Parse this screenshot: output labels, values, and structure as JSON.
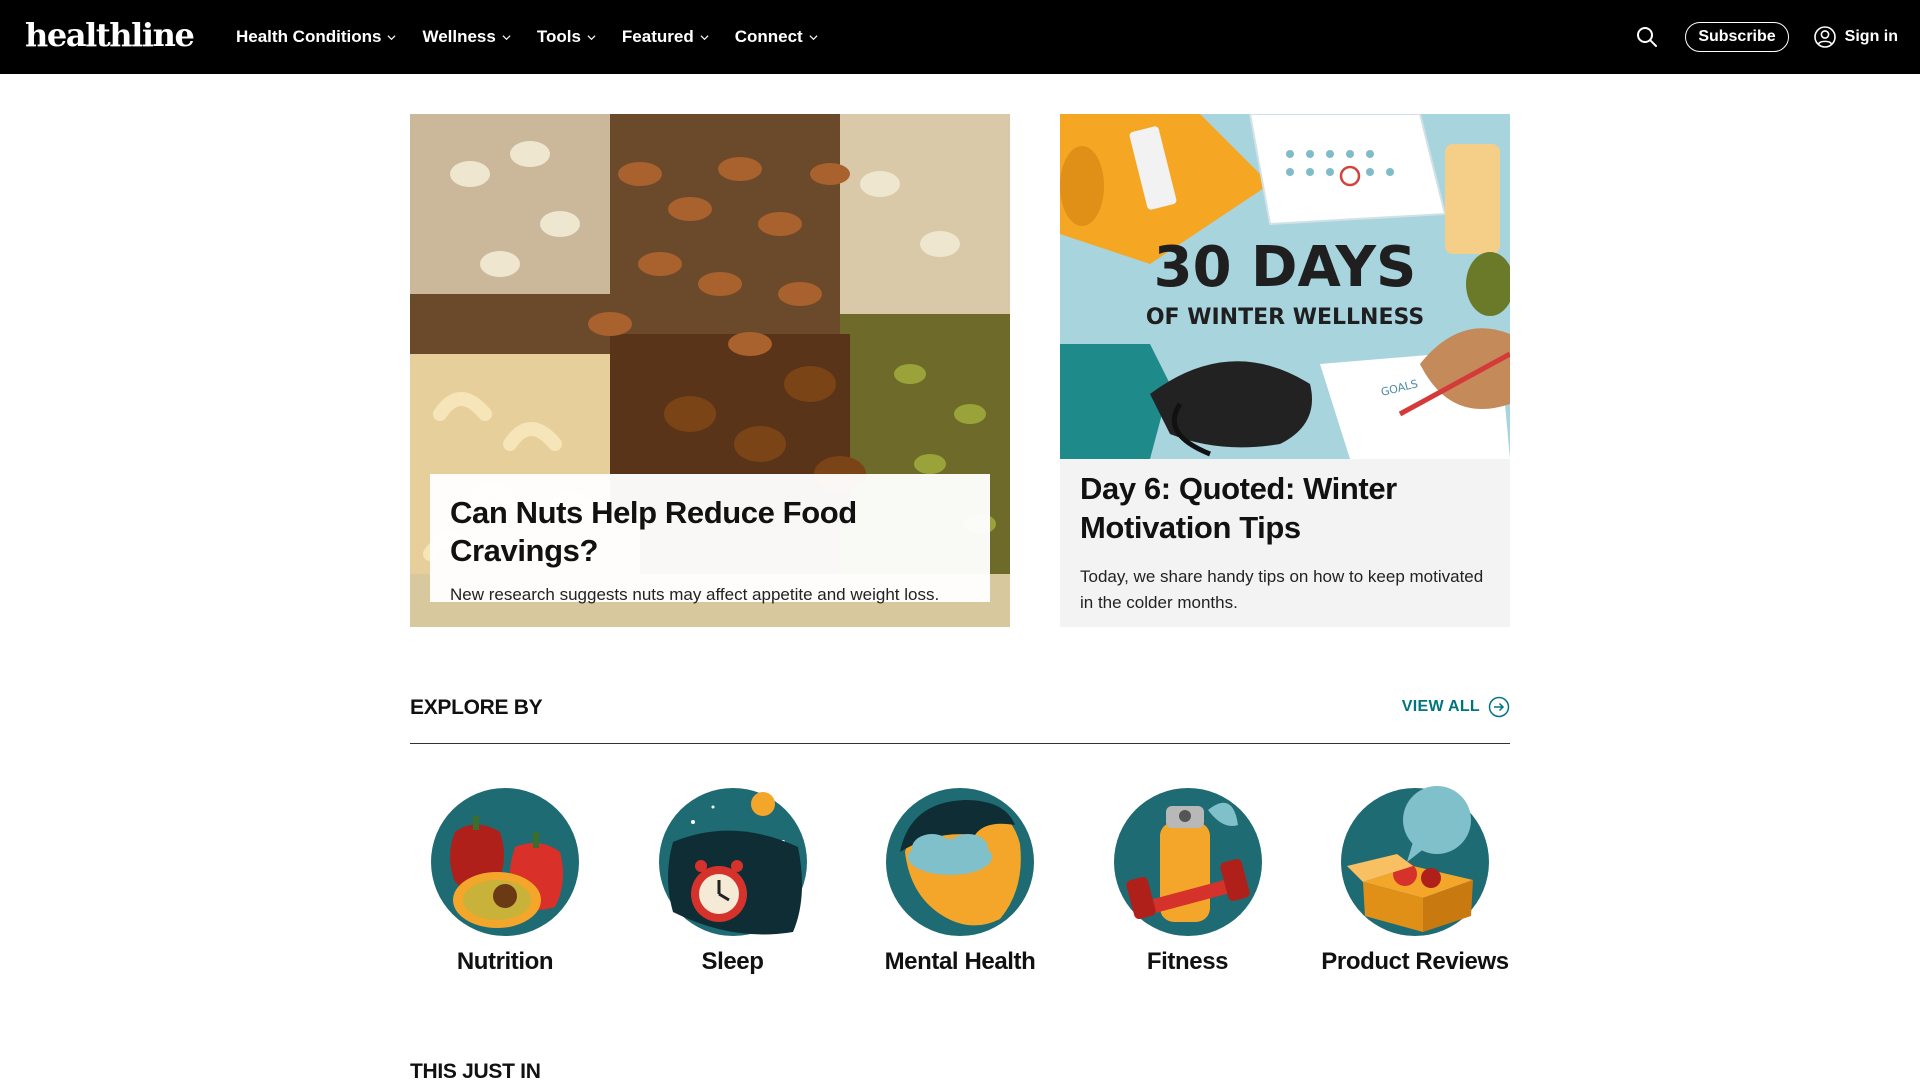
{
  "header": {
    "logo": "healthline",
    "nav": [
      {
        "label": "Health Conditions"
      },
      {
        "label": "Wellness"
      },
      {
        "label": "Tools"
      },
      {
        "label": "Featured"
      },
      {
        "label": "Connect"
      }
    ],
    "subscribe_label": "Subscribe",
    "signin_label": "Sign in"
  },
  "featured": [
    {
      "title": "Can Nuts Help Reduce Food Cravings?",
      "subtitle": "New research suggests nuts may affect appetite and weight loss."
    },
    {
      "title": "Day 6: Quoted: Winter Motivation Tips",
      "subtitle": "Today, we share handy tips on how to keep motivated in the colder months.",
      "art_line1": "30 DAYS",
      "art_line2": "OF WINTER WELLNESS",
      "art_note": "GOALS"
    }
  ],
  "explore": {
    "title": "EXPLORE BY",
    "view_all": "VIEW ALL",
    "topics": [
      {
        "label": "Nutrition",
        "icon": "nutrition-icon"
      },
      {
        "label": "Sleep",
        "icon": "sleep-icon"
      },
      {
        "label": "Mental Health",
        "icon": "mental-health-icon"
      },
      {
        "label": "Fitness",
        "icon": "fitness-icon"
      },
      {
        "label": "Product Reviews",
        "icon": "product-reviews-icon"
      }
    ]
  },
  "just_in": {
    "title": "THIS JUST IN"
  },
  "colors": {
    "teal": "#1e6b73",
    "accent_link": "#007580",
    "header_bg": "#000000"
  }
}
